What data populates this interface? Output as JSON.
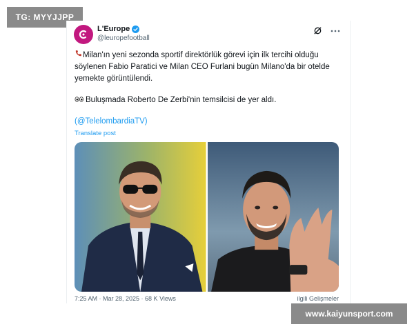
{
  "watermarks": {
    "top_left": "TG: MYYJJPP",
    "bottom_right": "www.kaiyunsport.com"
  },
  "tweet": {
    "author_name": "L'Europe",
    "author_handle": "@leuropefootball",
    "paragraph_1": "Milan'ın yeni sezonda sportif direktörlük görevi için ilk tercihi olduğu söylenen Fabio Paratici ve Milan CEO Furlani bugün Milano'da bir otelde yemekte görüntülendi.",
    "paragraph_2": "Buluşmada Roberto De Zerbi'nin temsilcisi de yer aldı.",
    "mention": "(@TelelombardiaTV)",
    "translate_label": "Translate post",
    "footer_left": "7:25 AM · Mar 28, 2025 · 68 K Views",
    "footer_right": "ilgili Gelişmeler"
  },
  "icons": {
    "avatar": "leurope-logo",
    "verified": "verified-badge-icon",
    "grok": "grok-icon",
    "more": "more-icon",
    "phone": "phone-emoji",
    "eyes": "eyes-emoji"
  },
  "colors": {
    "accent_link": "#1d9bf0",
    "avatar_bg": "#c2187f",
    "watermark_bg": "#8a8a8a"
  }
}
